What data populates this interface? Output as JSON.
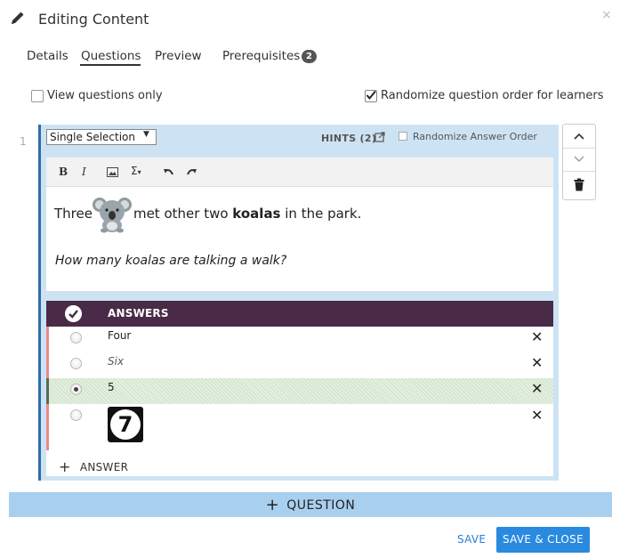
{
  "header": {
    "title": "Editing Content",
    "close_label": "×"
  },
  "tabs": [
    {
      "label": "Details",
      "active": false
    },
    {
      "label": "Questions",
      "active": true
    },
    {
      "label": "Preview",
      "active": false
    },
    {
      "label": "Prerequisites",
      "active": false,
      "badge": "2"
    }
  ],
  "options": {
    "view_questions_only": {
      "label": "View questions only",
      "checked": false
    },
    "randomize_order": {
      "label": "Randomize question order for learners",
      "checked": true
    }
  },
  "question": {
    "number": "1",
    "type": "Single Selection",
    "hints_label": "HINTS (2)",
    "randomize_answers_label": "Randomize Answer Order",
    "randomize_answers_checked": false,
    "toolbar": {
      "bold": "B",
      "italic": "I",
      "image": "image-icon",
      "sigma": "Σ",
      "undo": "undo-icon",
      "redo": "redo-icon"
    },
    "body": {
      "line1_before": "Three",
      "line1_after_a": "met other two ",
      "line1_bold": "koalas",
      "line1_after_b": " in the park.",
      "line2": "How many koalas are talking a walk?"
    },
    "answers_header": "ANSWERS",
    "answers": [
      {
        "text": "Four",
        "italic": false,
        "selected": false
      },
      {
        "text": "Six",
        "italic": true,
        "selected": false
      },
      {
        "text": "5",
        "italic": false,
        "selected": true
      },
      {
        "text": "",
        "image": "7",
        "selected": false
      }
    ],
    "add_answer_label": "ANSWER"
  },
  "add_question_label": "QUESTION",
  "footer": {
    "save_label": "SAVE",
    "save_close_label": "SAVE & CLOSE"
  },
  "colors": {
    "accent": "#2a8ae0",
    "answers_header": "#4a2b47",
    "panel": "#cde3f4",
    "add_question_bar": "#a9cfee"
  }
}
